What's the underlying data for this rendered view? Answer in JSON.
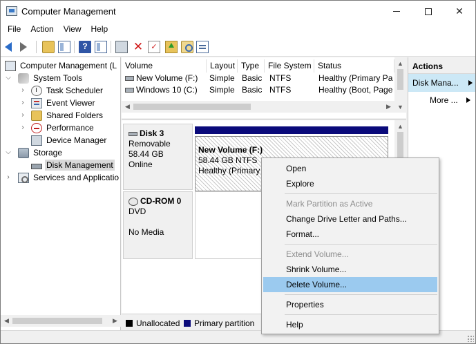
{
  "window": {
    "title": "Computer Management"
  },
  "menubar": {
    "items": [
      "File",
      "Action",
      "View",
      "Help"
    ]
  },
  "tree": {
    "items": [
      {
        "label": "Computer Management (L",
        "icon": "computer-management-icon"
      },
      {
        "label": "System Tools",
        "icon": "system-tools-icon"
      },
      {
        "label": "Task Scheduler",
        "icon": "task-scheduler-icon"
      },
      {
        "label": "Event Viewer",
        "icon": "event-viewer-icon"
      },
      {
        "label": "Shared Folders",
        "icon": "shared-folders-icon"
      },
      {
        "label": "Performance",
        "icon": "performance-icon"
      },
      {
        "label": "Device Manager",
        "icon": "device-manager-icon"
      },
      {
        "label": "Storage",
        "icon": "storage-icon"
      },
      {
        "label": "Disk Management",
        "icon": "disk-management-icon"
      },
      {
        "label": "Services and Applicatio",
        "icon": "services-icon"
      }
    ]
  },
  "volumes": {
    "columns": [
      "Volume",
      "Layout",
      "Type",
      "File System",
      "Status"
    ],
    "rows": [
      {
        "volume": "New Volume (F:)",
        "layout": "Simple",
        "type": "Basic",
        "fs": "NTFS",
        "status": "Healthy (Primary Pa"
      },
      {
        "volume": "Windows 10 (C:)",
        "layout": "Simple",
        "type": "Basic",
        "fs": "NTFS",
        "status": "Healthy (Boot, Page"
      }
    ]
  },
  "disks": {
    "disk3": {
      "name": "Disk 3",
      "kind": "Removable",
      "size": "58.44 GB",
      "state": "Online",
      "partition": {
        "title": "New Volume  (F:)",
        "size": "58.44 GB NTFS",
        "status": "Healthy (Primary"
      }
    },
    "cdrom": {
      "name": "CD-ROM 0",
      "kind": "DVD",
      "state": "No Media"
    }
  },
  "legend": {
    "unallocated": "Unallocated",
    "primary": "Primary partition",
    "unallocated_color": "#000000",
    "primary_color": "#0a0a7a"
  },
  "actions": {
    "header": "Actions",
    "selected": "Disk Mana...",
    "more": "More ..."
  },
  "context_menu": {
    "items": [
      {
        "label": "Open",
        "enabled": true
      },
      {
        "label": "Explore",
        "enabled": true
      },
      {
        "label": "Mark Partition as Active",
        "enabled": false
      },
      {
        "label": "Change Drive Letter and Paths...",
        "enabled": true
      },
      {
        "label": "Format...",
        "enabled": true
      },
      {
        "label": "Extend Volume...",
        "enabled": false
      },
      {
        "label": "Shrink Volume...",
        "enabled": true
      },
      {
        "label": "Delete Volume...",
        "enabled": true,
        "highlighted": true
      },
      {
        "label": "Properties",
        "enabled": true
      },
      {
        "label": "Help",
        "enabled": true
      }
    ]
  },
  "colors": {
    "highlight": "#9bcaef",
    "selection": "#cce8f6",
    "partition_bar": "#0a0a7a"
  }
}
